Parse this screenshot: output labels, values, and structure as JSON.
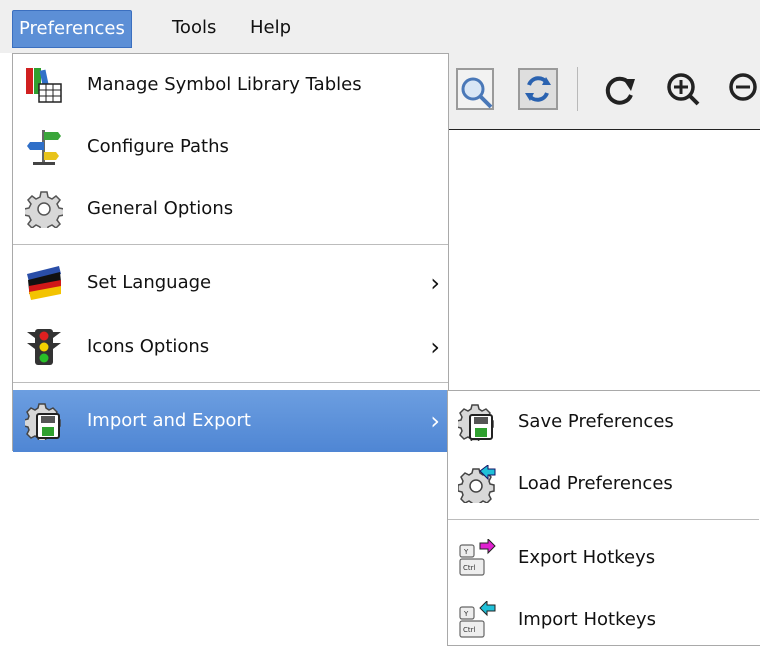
{
  "menubar": {
    "items": [
      {
        "label": "Preferences"
      },
      {
        "label": "Tools"
      },
      {
        "label": "Help"
      }
    ]
  },
  "toolbar": {
    "icons": [
      "zoom-page-icon",
      "redraw-icon",
      "rotate-icon",
      "zoom-in-icon",
      "zoom-out-icon"
    ]
  },
  "preferences_menu": {
    "items": [
      {
        "label": "Manage Symbol Library Tables",
        "icon": "library-table-icon"
      },
      {
        "label": "Configure Paths",
        "icon": "signpost-icon"
      },
      {
        "label": "General Options",
        "icon": "gear-icon"
      },
      {
        "label": "Set Language",
        "icon": "flag-icon",
        "submenu": true
      },
      {
        "label": "Icons Options",
        "icon": "traffic-light-icon",
        "submenu": true
      },
      {
        "label": "Import and Export",
        "icon": "gear-save-icon",
        "submenu": true,
        "highlighted": true
      }
    ]
  },
  "import_export_submenu": {
    "items": [
      {
        "label": "Save Preferences",
        "icon": "gear-save-icon"
      },
      {
        "label": "Load Preferences",
        "icon": "gear-load-icon"
      },
      {
        "label": "Export Hotkeys",
        "icon": "hotkey-export-icon"
      },
      {
        "label": "Import Hotkeys",
        "icon": "hotkey-import-icon"
      }
    ]
  },
  "colors": {
    "highlight": "#5c8fd6",
    "menubar_bg": "#efefef"
  }
}
